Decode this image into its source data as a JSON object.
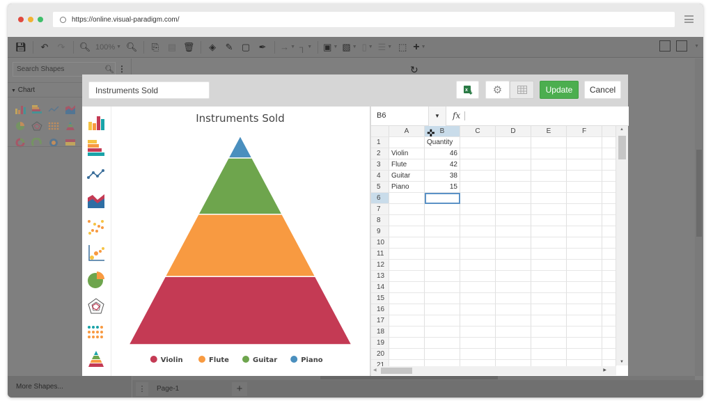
{
  "browser": {
    "url": "https://online.visual-paradigm.com/",
    "traffic_lights": {
      "close": "#e04a3f",
      "minimize": "#f2b233",
      "maximize": "#3fbf6a"
    }
  },
  "toolbar": {
    "zoom_level": "100%",
    "items": [
      "save-icon",
      "undo-icon",
      "redo-icon",
      "zoom-out-icon",
      "zoom-in-icon",
      "copy-icon",
      "paste-icon",
      "delete-icon",
      "fill-icon",
      "line-color-icon",
      "shadow-icon",
      "format-painter-icon",
      "connector-icon",
      "waypoint-icon",
      "arrange-icon",
      "layer-icon",
      "align-icon",
      "distribute-icon",
      "select-all-icon",
      "add-icon",
      "panel-icon",
      "layout-icon"
    ]
  },
  "sidebar": {
    "search_placeholder": "Search Shapes",
    "category": "Chart",
    "more_shapes": "More Shapes..."
  },
  "pages": {
    "current": "Page-1"
  },
  "dialog": {
    "chart_title_value": "Instruments Sold",
    "buttons": {
      "update": "Update",
      "cancel": "Cancel"
    },
    "chart_types": [
      "column-chart",
      "bar-chart",
      "line-chart",
      "area-chart",
      "scatter-chart",
      "bubble-chart",
      "pie-chart",
      "radar-chart",
      "dot-matrix-chart",
      "pyramid-chart"
    ],
    "colors": {
      "violin": "#c43a54",
      "flute": "#f89a41",
      "guitar": "#6ea54d",
      "piano": "#4a8fbe",
      "update_button": "#4cae4f"
    }
  },
  "spreadsheet": {
    "cell_ref": "B6",
    "formula": "",
    "columns": [
      "A",
      "B",
      "C",
      "D",
      "E",
      "F"
    ],
    "row_numbers": [
      "1",
      "2",
      "3",
      "4",
      "5",
      "6",
      "7",
      "8",
      "9",
      "10",
      "11",
      "12",
      "13",
      "14",
      "15",
      "16",
      "17",
      "18",
      "19",
      "20",
      "21"
    ],
    "rows": [
      [
        "",
        "Quantity"
      ],
      [
        "Violin",
        "46"
      ],
      [
        "Flute",
        "42"
      ],
      [
        "Guitar",
        "38"
      ],
      [
        "Piano",
        "15"
      ]
    ],
    "selected_cell": "B6"
  },
  "chart_data": {
    "type": "pyramid",
    "title": "Instruments Sold",
    "categories": [
      "Violin",
      "Flute",
      "Guitar",
      "Piano"
    ],
    "values": [
      46,
      42,
      38,
      15
    ],
    "series_name": "Quantity",
    "legend_position": "bottom",
    "colors": [
      "#c43a54",
      "#f89a41",
      "#6ea54d",
      "#4a8fbe"
    ]
  }
}
